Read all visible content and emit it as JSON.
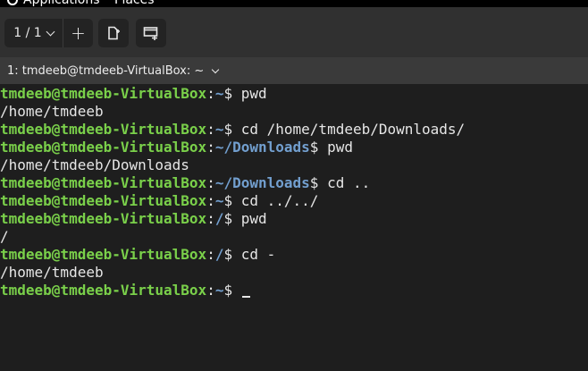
{
  "top_panel": {
    "applications_label": "Applications",
    "places_label": "Places"
  },
  "toolbar": {
    "tab_count": "1 / 1",
    "add_tab_glyph": "+",
    "split_icon": "new-split-icon",
    "window_icon": "new-window-icon"
  },
  "tab": {
    "title": "1: tmdeeb@tmdeeb-VirtualBox: ~"
  },
  "colors": {
    "prompt_user": "#7ad04a",
    "prompt_path": "#729fcf",
    "terminal_bg": "#1e1e1e",
    "text": "#e6e6e6"
  },
  "terminal": {
    "user_host": "tmdeeb@tmdeeb-VirtualBox",
    "lines": [
      {
        "type": "prompt",
        "dir": "~",
        "cmd": "pwd"
      },
      {
        "type": "output",
        "text": "/home/tmdeeb"
      },
      {
        "type": "prompt",
        "dir": "~",
        "cmd": "cd /home/tmdeeb/Downloads/"
      },
      {
        "type": "prompt",
        "dir": "~/Downloads",
        "cmd": "pwd"
      },
      {
        "type": "output",
        "text": "/home/tmdeeb/Downloads"
      },
      {
        "type": "prompt",
        "dir": "~/Downloads",
        "cmd": "cd .."
      },
      {
        "type": "prompt",
        "dir": "~",
        "cmd": "cd ../../"
      },
      {
        "type": "prompt",
        "dir": "/",
        "cmd": "pwd"
      },
      {
        "type": "output",
        "text": "/"
      },
      {
        "type": "prompt",
        "dir": "/",
        "cmd": "cd -"
      },
      {
        "type": "output",
        "text": "/home/tmdeeb"
      },
      {
        "type": "prompt",
        "dir": "~",
        "cmd": "",
        "cursor": true
      }
    ]
  }
}
